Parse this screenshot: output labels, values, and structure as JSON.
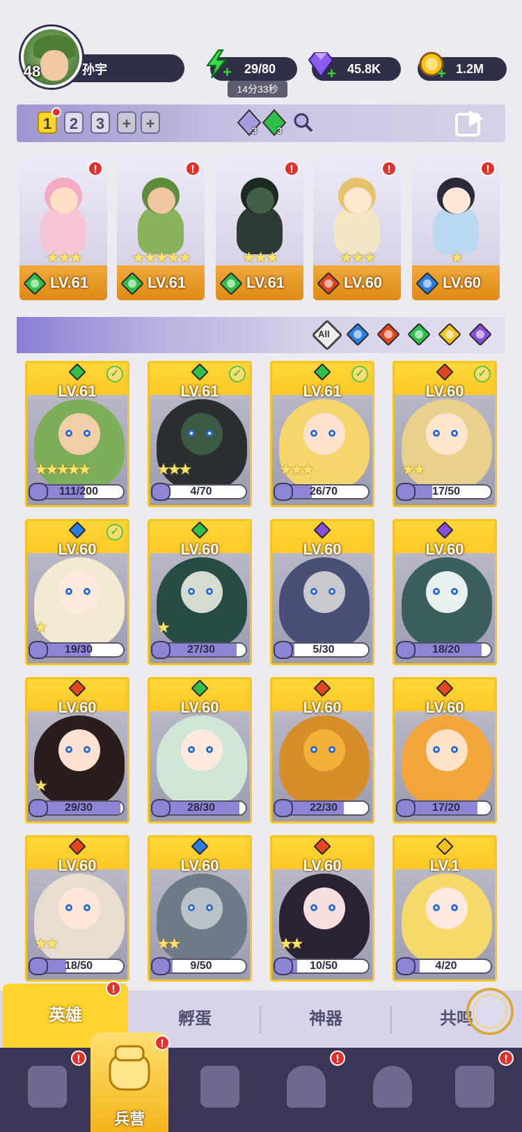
{
  "player": {
    "level": "48",
    "name": "孙宇"
  },
  "resources": {
    "energy": {
      "value": "29/80",
      "timer": "14分33秒",
      "icon": "lightning-icon"
    },
    "gems": {
      "value": "45.8K",
      "icon": "gem-icon"
    },
    "gold": {
      "value": "1.2M",
      "icon": "coin-icon"
    }
  },
  "team_bar": {
    "tabs": [
      "1",
      "2",
      "3",
      "+",
      "+"
    ],
    "gems": [
      {
        "count": "3",
        "color": "#a89be0"
      },
      {
        "count": "3",
        "color": "#2fbf4a"
      }
    ]
  },
  "team": [
    {
      "level": "LV.61",
      "element": "wind",
      "stars": "★★★"
    },
    {
      "level": "LV.61",
      "element": "wind",
      "stars": "★★★★★"
    },
    {
      "level": "LV.61",
      "element": "wind",
      "stars": "★★★"
    },
    {
      "level": "LV.60",
      "element": "fire",
      "stars": "★★★"
    },
    {
      "level": "LV.60",
      "element": "water",
      "stars": "★"
    }
  ],
  "filter": {
    "all_label": "All"
  },
  "heroes": [
    {
      "level": "LV.61",
      "element": "wind",
      "checked": true,
      "stars": "★★★★★",
      "fragments": "111/200",
      "progress": 0.555
    },
    {
      "level": "LV.61",
      "element": "wind",
      "checked": true,
      "stars": "★★★",
      "fragments": "4/70",
      "progress": 0.057
    },
    {
      "level": "LV.61",
      "element": "wind",
      "checked": true,
      "stars": "★★★",
      "fragments": "26/70",
      "progress": 0.371
    },
    {
      "level": "LV.60",
      "element": "fire",
      "checked": true,
      "stars": "★★",
      "fragments": "17/50",
      "progress": 0.34
    },
    {
      "level": "LV.60",
      "element": "water",
      "checked": true,
      "stars": "★",
      "fragments": "19/30",
      "progress": 0.633
    },
    {
      "level": "LV.60",
      "element": "wind",
      "checked": false,
      "stars": "★",
      "fragments": "27/30",
      "progress": 0.9
    },
    {
      "level": "LV.60",
      "element": "dark",
      "checked": false,
      "stars": "",
      "fragments": "5/30",
      "progress": 0.167
    },
    {
      "level": "LV.60",
      "element": "dark",
      "checked": false,
      "stars": "",
      "fragments": "18/20",
      "progress": 0.9
    },
    {
      "level": "LV.60",
      "element": "fire",
      "checked": false,
      "stars": "★",
      "fragments": "29/30",
      "progress": 0.967
    },
    {
      "level": "LV.60",
      "element": "wind",
      "checked": false,
      "stars": "",
      "fragments": "28/30",
      "progress": 0.933
    },
    {
      "level": "LV.60",
      "element": "fire",
      "checked": false,
      "stars": "",
      "fragments": "22/30",
      "progress": 0.733
    },
    {
      "level": "LV.60",
      "element": "fire",
      "checked": false,
      "stars": "",
      "fragments": "17/20",
      "progress": 0.85
    },
    {
      "level": "LV.60",
      "element": "fire",
      "checked": false,
      "stars": "★★",
      "fragments": "18/50",
      "progress": 0.36
    },
    {
      "level": "LV.60",
      "element": "water",
      "checked": false,
      "stars": "★★",
      "fragments": "9/50",
      "progress": 0.18
    },
    {
      "level": "LV.60",
      "element": "fire",
      "checked": false,
      "stars": "★★",
      "fragments": "10/50",
      "progress": 0.2
    },
    {
      "level": "LV.1",
      "element": "light",
      "checked": false,
      "stars": "",
      "fragments": "4/20",
      "progress": 0.2
    }
  ],
  "subtabs": [
    "英雄",
    "孵蛋",
    "神器",
    "共鸣"
  ],
  "nav": {
    "active_label": "兵营"
  },
  "colors": {
    "wind": "#2fbf4a",
    "fire": "#e2461f",
    "water": "#2c7de0",
    "light": "#f2c21e",
    "dark": "#8a4fd8",
    "accent": "#ffd42e"
  }
}
